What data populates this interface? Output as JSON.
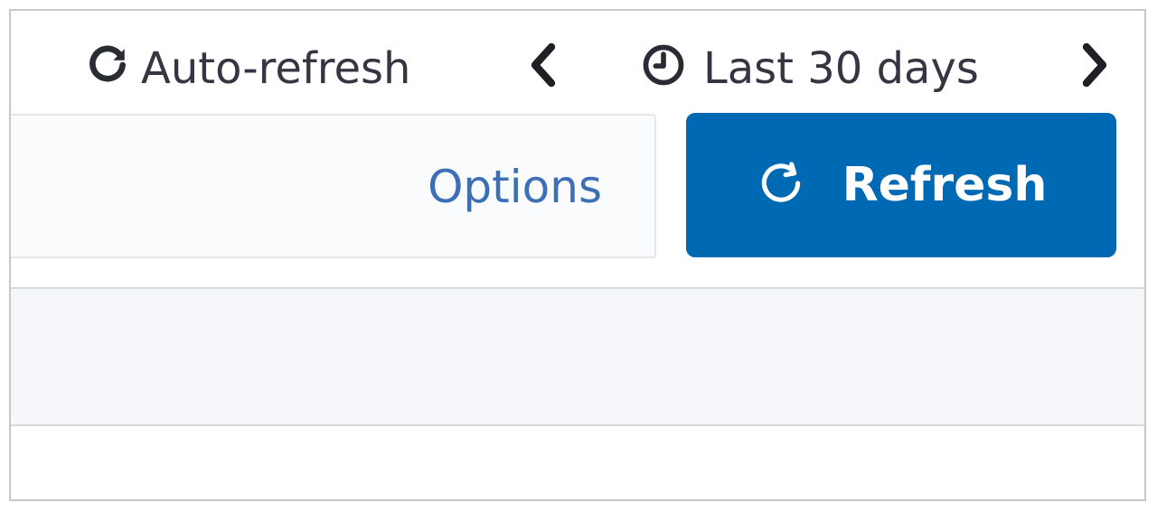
{
  "toolbar": {
    "auto_refresh_label": "Auto-refresh",
    "auto_refresh_icon": "refresh-icon",
    "prev_icon": "chevron-left-icon",
    "date_range_label": "Last 30 days",
    "date_range_icon": "clock-icon",
    "next_icon": "chevron-right-icon"
  },
  "query_bar": {
    "options_label": "Options",
    "refresh_button_label": "Refresh",
    "refresh_button_icon": "refresh-icon"
  },
  "colors": {
    "primary": "#0069b4",
    "link": "#3c6fb5",
    "text": "#343741",
    "band": "#f5f7fa"
  }
}
